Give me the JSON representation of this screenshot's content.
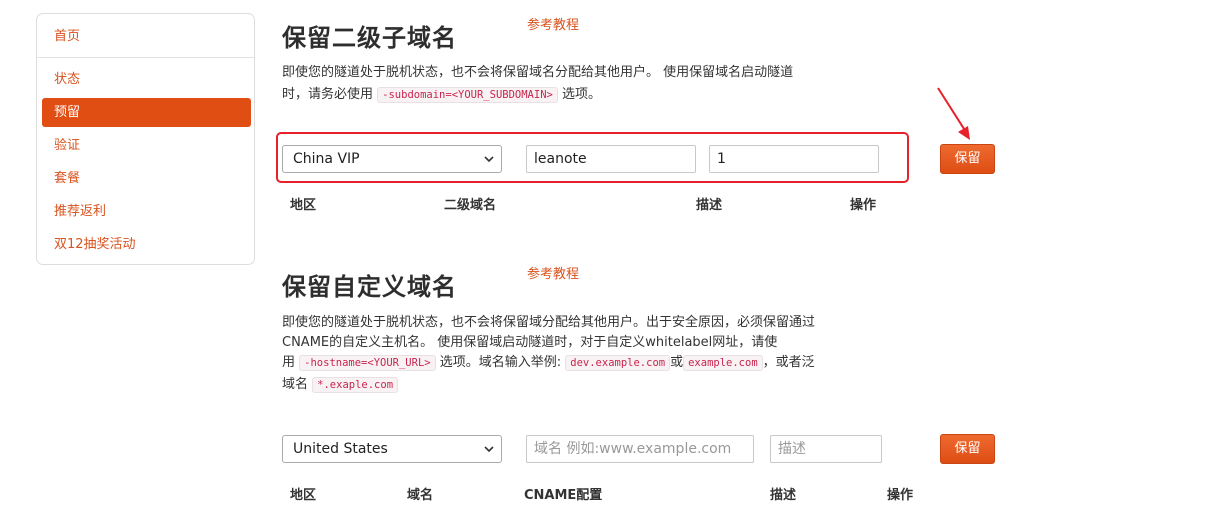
{
  "sidebar": {
    "items": [
      {
        "label": "首页",
        "active": false
      },
      {
        "label": "状态",
        "active": false
      },
      {
        "label": "预留",
        "active": true
      },
      {
        "label": "验证",
        "active": false
      },
      {
        "label": "套餐",
        "active": false
      },
      {
        "label": "推荐返利",
        "active": false
      },
      {
        "label": "双12抽奖活动",
        "active": false
      }
    ]
  },
  "subdomain_section": {
    "title": "保留二级子域名",
    "ref_link": "参考教程",
    "desc_line1": "即使您的隧道处于脱机状态，也不会将保留域名分配给其他用户。 使用保留域名启动隧道",
    "desc_line2_a": "时，请务必使用",
    "desc_line2_code": "-subdomain=<YOUR_SUBDOMAIN>",
    "desc_line2_b": "选项。",
    "form": {
      "region_selected": "China VIP",
      "subdomain_value": "leanote",
      "description_value": "1",
      "reserve_button": "保留"
    },
    "columns": [
      "地区",
      "二级域名",
      "描述",
      "操作"
    ]
  },
  "custom_domain_section": {
    "title": "保留自定义域名",
    "ref_link": "参考教程",
    "desc_line1": "即使您的隧道处于脱机状态，也不会将保留域分配给其他用户。出于安全原因，必须保留通过",
    "desc_line2": "CNAME的自定义主机名。 使用保留域启动隧道时，对于自定义whitelabel网址，请使",
    "desc_line3_a": "用",
    "desc_line3_code1": "-hostname=<YOUR_URL>",
    "desc_line3_b": "选项。域名输入举例:",
    "desc_line3_code2": "dev.example.com",
    "desc_line3_c": "或",
    "desc_line3_code3": "example.com",
    "desc_line3_d": "，或者泛",
    "desc_line4_a": "域名",
    "desc_line4_code": "*.exaple.com",
    "form": {
      "region_selected": "United States",
      "domain_placeholder": "域名 例如:www.example.com",
      "description_placeholder": "描述",
      "reserve_button": "保留"
    },
    "columns": [
      "地区",
      "域名",
      "CNAME配置",
      "描述",
      "操作"
    ]
  },
  "colors": {
    "accent": "#e04e14",
    "link": "#d9531e",
    "annotation": "#e8202a"
  }
}
